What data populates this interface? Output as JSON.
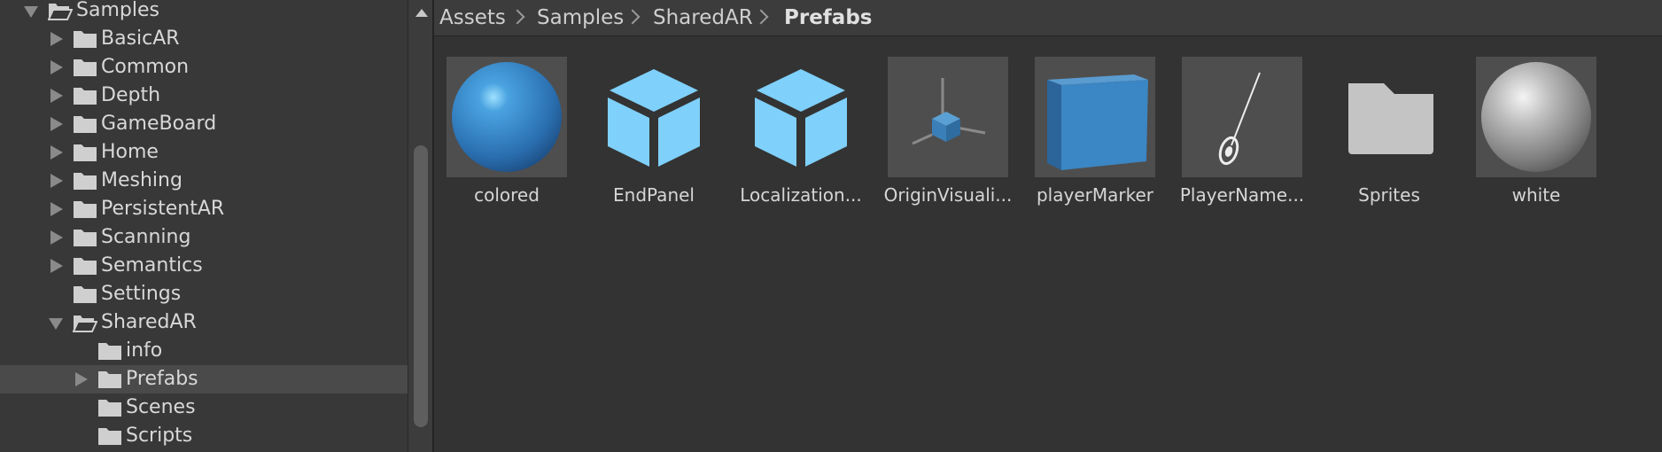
{
  "tree": {
    "items": [
      {
        "label": "Samples",
        "expanded": true,
        "arrow": "down"
      },
      {
        "label": "BasicAR",
        "arrow": "right"
      },
      {
        "label": "Common",
        "arrow": "right"
      },
      {
        "label": "Depth",
        "arrow": "right"
      },
      {
        "label": "GameBoard",
        "arrow": "right"
      },
      {
        "label": "Home",
        "arrow": "right"
      },
      {
        "label": "Meshing",
        "arrow": "right"
      },
      {
        "label": "PersistentAR",
        "arrow": "right"
      },
      {
        "label": "Scanning",
        "arrow": "right"
      },
      {
        "label": "Semantics",
        "arrow": "right"
      },
      {
        "label": "Settings",
        "arrow": "none"
      },
      {
        "label": "SharedAR",
        "expanded": true,
        "arrow": "down"
      },
      {
        "label": "info",
        "arrow": "none"
      },
      {
        "label": "Prefabs",
        "arrow": "right",
        "selected": true
      },
      {
        "label": "Scenes",
        "arrow": "none"
      },
      {
        "label": "Scripts",
        "arrow": "none"
      }
    ]
  },
  "breadcrumb": {
    "items": [
      "Assets",
      "Samples",
      "SharedAR",
      "Prefabs"
    ]
  },
  "assets": [
    {
      "label": "colored",
      "icon": "blue-sphere-icon"
    },
    {
      "label": "EndPanel",
      "icon": "prefab-cube-icon"
    },
    {
      "label": "Localization...",
      "icon": "prefab-cube-icon"
    },
    {
      "label": "OriginVisuali...",
      "icon": "origin-gizmo-icon"
    },
    {
      "label": "playerMarker",
      "icon": "blue-cube-icon"
    },
    {
      "label": "PlayerName...",
      "icon": "pin-marker-icon"
    },
    {
      "label": "Sprites",
      "icon": "folder-icon"
    },
    {
      "label": "white",
      "icon": "white-sphere-icon"
    }
  ],
  "colors": {
    "prefab_blue": "#7fd0fa",
    "material_blue": "#3b86c4",
    "folder_gray": "#c4c4c4",
    "selection": "#4a4a4a"
  }
}
